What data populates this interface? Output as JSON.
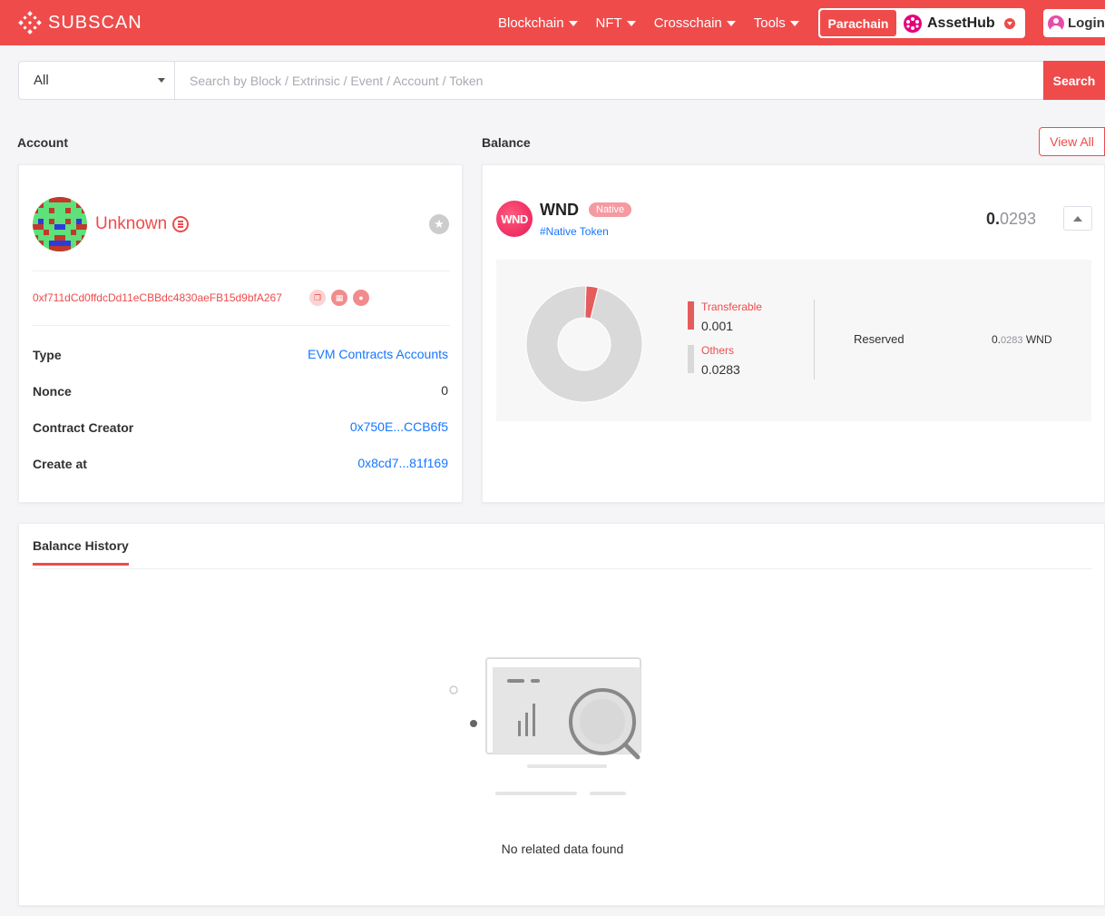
{
  "header": {
    "logo": "SUBSCAN",
    "nav": [
      "Blockchain",
      "NFT",
      "Crosschain",
      "Tools"
    ],
    "network_type": "Parachain",
    "network_name": "AssetHub",
    "login": "Login",
    "brand_color": "#ef4b4b"
  },
  "search": {
    "filter": "All",
    "placeholder": "Search by Block / Extrinsic / Event / Account / Token",
    "button": "Search"
  },
  "account": {
    "section_title": "Account",
    "name": "Unknown",
    "address": "0xf711dCd0ffdcDd11eCBBdc4830aeFB15d9bfA267",
    "rows": [
      {
        "label": "Type",
        "value": "EVM Contracts Accounts"
      },
      {
        "label": "Nonce",
        "value": "0"
      },
      {
        "label": "Contract Creator",
        "value": "0x750E...CCB6f5"
      },
      {
        "label": "Create at",
        "value": "0x8cd7...81f169"
      }
    ]
  },
  "balance": {
    "section_title": "Balance",
    "view_all": "View All",
    "token": {
      "logo_text": "WND",
      "symbol": "WND",
      "tag": "Native",
      "subtitle": "#Native Token",
      "total_int": "0.",
      "total_dec": "0293"
    },
    "legend": [
      {
        "label": "Transferable",
        "value": "0.001",
        "color": "#e55c5c"
      },
      {
        "label": "Others",
        "value": "0.0283",
        "color": "#d9d9d9"
      }
    ],
    "reserved": {
      "label": "Reserved",
      "value_int": "0.",
      "value_dec": "0283",
      "unit": "WND"
    }
  },
  "history": {
    "tab": "Balance History",
    "empty": "No related data found"
  },
  "chart_data": {
    "type": "pie",
    "categories": [
      "Transferable",
      "Others"
    ],
    "values": [
      0.001,
      0.0283
    ],
    "colors": [
      "#e55c5c",
      "#d9d9d9"
    ]
  }
}
